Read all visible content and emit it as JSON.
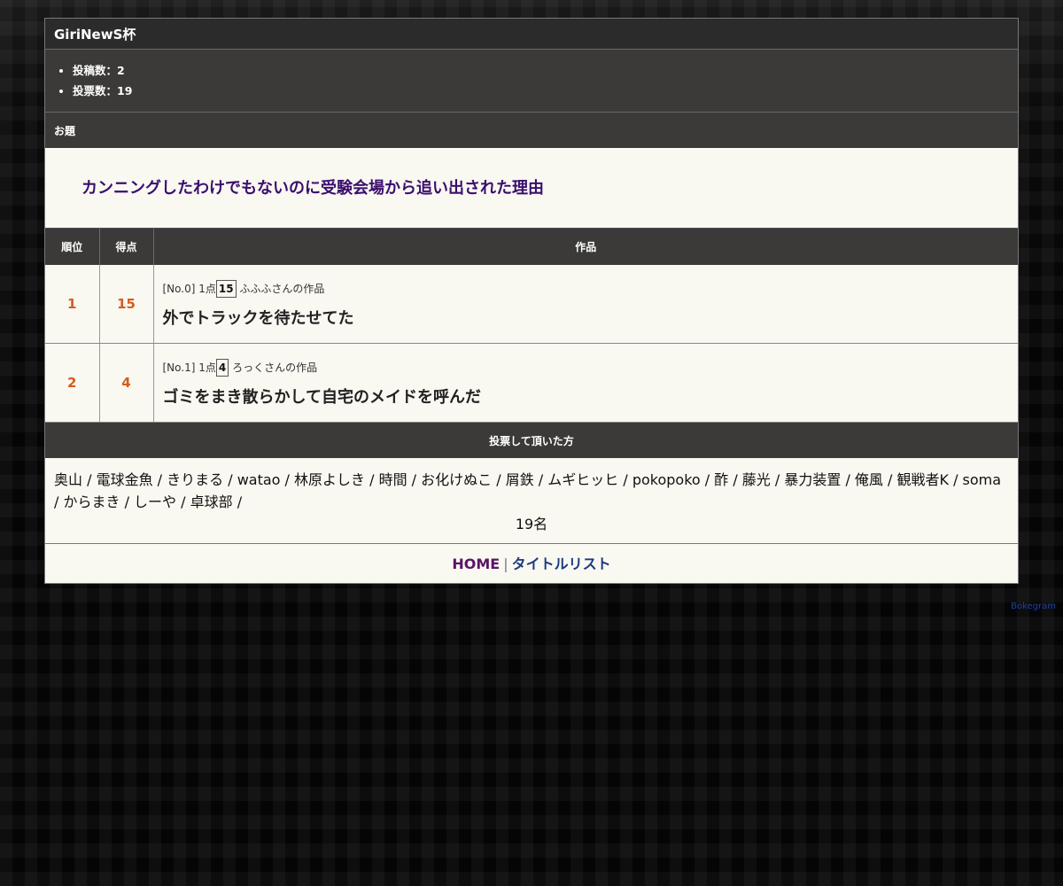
{
  "contest": {
    "title": "GiriNewS杯",
    "stats": [
      {
        "label": "投稿数：2"
      },
      {
        "label": "投票数：19"
      }
    ]
  },
  "theme": {
    "heading": "お題",
    "text": "カンニングしたわけでもないのに受験会場から追い出された理由"
  },
  "results": {
    "headers": {
      "rank": "順位",
      "score": "得点",
      "entry": "作品"
    },
    "rows": [
      {
        "rank": "1",
        "score": "15",
        "meta_prefix": "[No.0] 1点",
        "points": "15",
        "author": "ふふふさんの作品",
        "text": "外でトラックを待たせてた"
      },
      {
        "rank": "2",
        "score": "4",
        "meta_prefix": "[No.1] 1点",
        "points": "4",
        "author": "ろっくさんの作品",
        "text": "ゴミをまき散らかして自宅のメイドを呼んだ"
      }
    ]
  },
  "voters": {
    "heading": "投票して頂いた方",
    "names": "奥山 / 電球金魚 / きりまる / watao / 林原よしき / 時間 / お化けぬこ / 屑鉄 / ムギヒッヒ / pokopoko / 酢 / 藤光 / 暴力装置 / 俺風 / 観戦者K / soma / からまき / しーや / 卓球部 /",
    "count": "19名"
  },
  "footer": {
    "home": "HOME",
    "separator": "|",
    "title_list": "タイトルリスト"
  },
  "brand": "Bokegram"
}
